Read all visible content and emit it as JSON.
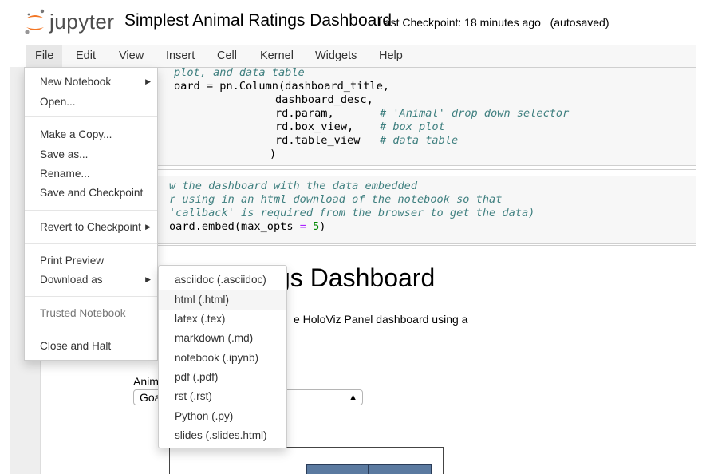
{
  "header": {
    "logo_text": "jupyter",
    "notebook_name": "Simplest Animal Ratings Dashboard",
    "checkpoint": "Last Checkpoint: 18 minutes ago",
    "autosave": "(autosaved)"
  },
  "menubar": {
    "items": [
      "File",
      "Edit",
      "View",
      "Insert",
      "Cell",
      "Kernel",
      "Widgets",
      "Help"
    ]
  },
  "code_cell_1": {
    "lines": [
      {
        "parts": [
          {
            "t": "plot, and data table",
            "c": "cm"
          }
        ]
      },
      {
        "parts": [
          {
            "t": "oard = pn.Column(dashboard_title,",
            "c": ""
          }
        ]
      },
      {
        "parts": [
          {
            "t": "dashboard_desc,",
            "c": ""
          }
        ]
      },
      {
        "parts": [
          {
            "t": "rd.param,",
            "c": ""
          },
          {
            "t": "       # 'Animal' drop down selector",
            "c": "cm"
          }
        ]
      },
      {
        "parts": [
          {
            "t": "rd.box_view,",
            "c": ""
          },
          {
            "t": "    # box plot",
            "c": "cm"
          }
        ]
      },
      {
        "parts": [
          {
            "t": "rd.table_view",
            "c": ""
          },
          {
            "t": "   # data table",
            "c": "cm"
          }
        ]
      },
      {
        "parts": [
          {
            "t": ")",
            "c": ""
          }
        ]
      }
    ]
  },
  "code_cell_2": {
    "lines": [
      {
        "parts": [
          {
            "t": "w the dashboard with the data embedded",
            "c": "cm"
          }
        ]
      },
      {
        "parts": [
          {
            "t": "r using in an html download of the notebook so that",
            "c": "cm"
          }
        ]
      },
      {
        "parts": [
          {
            "t": "'callback' is required from the browser to get the data)",
            "c": "cm"
          }
        ]
      },
      {
        "parts": [
          {
            "t": "oard.embed(max_opts ",
            "c": ""
          },
          {
            "t": "=",
            "c": "op"
          },
          {
            "t": " ",
            "c": ""
          },
          {
            "t": "5",
            "c": "num"
          },
          {
            "t": ")",
            "c": ""
          }
        ]
      }
    ]
  },
  "output": {
    "title": "gs Dashboard",
    "description": "e HoloViz Panel dashboard using a",
    "animal_label": "Anim",
    "animal_select_value": "Goa"
  },
  "file_menu": {
    "items": [
      {
        "label": "New Notebook",
        "submenu": true,
        "disabled": false
      },
      {
        "label": "Open...",
        "submenu": false,
        "disabled": false
      },
      {
        "label": "Make a Copy...",
        "submenu": false,
        "disabled": false
      },
      {
        "label": "Save as...",
        "submenu": false,
        "disabled": false
      },
      {
        "label": "Rename...",
        "submenu": false,
        "disabled": false
      },
      {
        "label": "Save and Checkpoint",
        "submenu": false,
        "disabled": false
      },
      {
        "label": "Revert to Checkpoint",
        "submenu": true,
        "disabled": false
      },
      {
        "label": "Print Preview",
        "submenu": false,
        "disabled": false
      },
      {
        "label": "Download as",
        "submenu": true,
        "disabled": false
      },
      {
        "label": "Trusted Notebook",
        "submenu": false,
        "disabled": true
      },
      {
        "label": "Close and Halt",
        "submenu": false,
        "disabled": false
      }
    ]
  },
  "download_menu": {
    "items": [
      "asciidoc (.asciidoc)",
      "html (.html)",
      "latex (.tex)",
      "markdown (.md)",
      "notebook (.ipynb)",
      "pdf (.pdf)",
      "rst (.rst)",
      "Python (.py)",
      "slides (.slides.html)"
    ],
    "highlighted": "html (.html)"
  },
  "colors": {
    "logo_orange": "#f37726",
    "menubar_bg": "#f7f7f7",
    "comment": "#408080",
    "number": "#008800",
    "box_fill": "#5b7aa0"
  }
}
